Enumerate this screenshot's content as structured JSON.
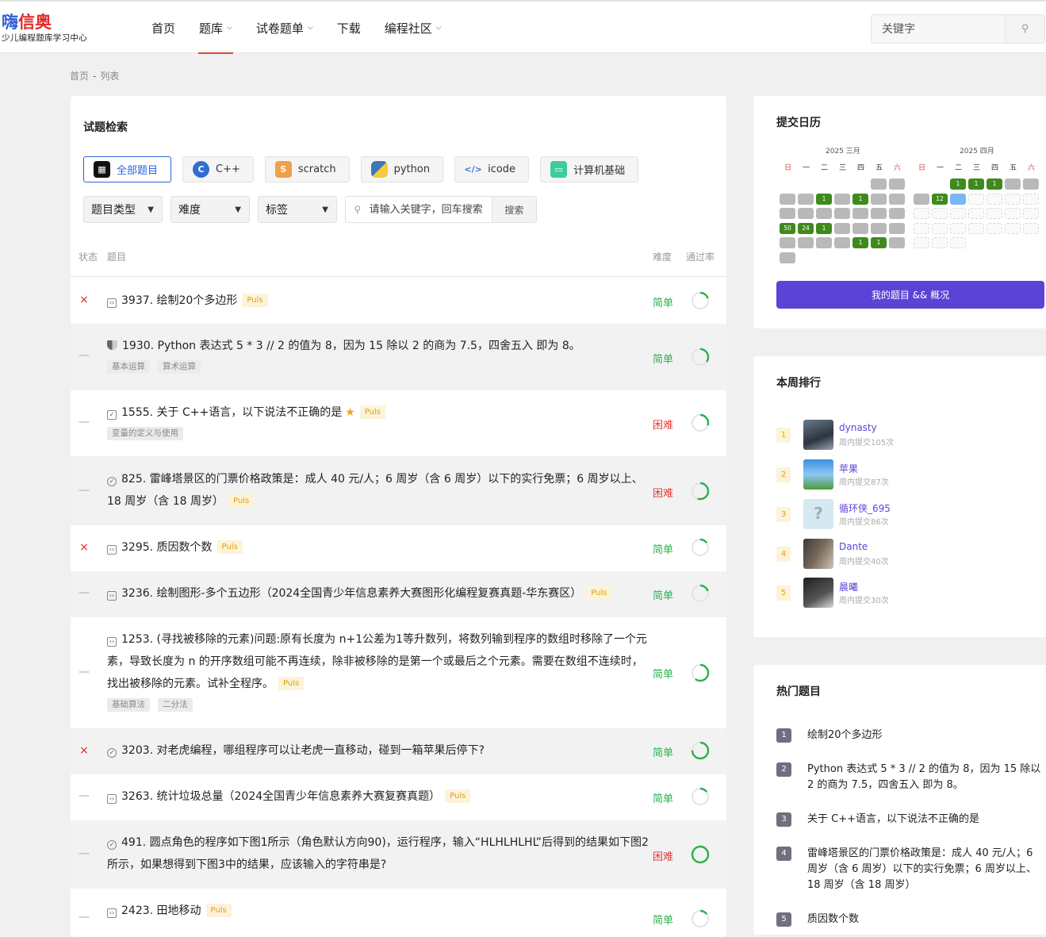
{
  "header": {
    "logo_part1": "嗨",
    "logo_part2": "信奥",
    "slogan": "少儿编程题库学习中心",
    "nav": [
      "首页",
      "题库",
      "试卷题单",
      "下载",
      "编程社区"
    ],
    "search_placeholder": "关键字"
  },
  "breadcrumb": {
    "home": "首页",
    "sep": "-",
    "current": "列表"
  },
  "main": {
    "title": "试题检索",
    "categories": [
      "全部题目",
      "C++",
      "scratch",
      "python",
      "icode",
      "计算机基础"
    ],
    "filters": {
      "type": "题目类型",
      "difficulty": "难度",
      "tag": "标签",
      "keyword_placeholder": "请输入关键字，回车搜索",
      "search_btn": "搜索"
    },
    "columns": {
      "status": "状态",
      "title": "题目",
      "difficulty": "难度",
      "rate": "通过率"
    },
    "problems": [
      {
        "status": "×",
        "title": "3937. 绘制20个多边形",
        "puls": "Puls",
        "diff": "简单",
        "rate": 0.2
      },
      {
        "status": "—",
        "title": "1930. Python 表达式 5 * 3 // 2 的值为 8，因为 15 除以 2 的商为 7.5，四舍五入 即为 8。",
        "tags": [
          "基本运算",
          "算术运算"
        ],
        "diff": "简单",
        "rate": 0.35
      },
      {
        "status": "—",
        "title": "1555. 关于 C++语言，以下说法不正确的是",
        "puls": "Puls",
        "tags": [
          "变量的定义与使用"
        ],
        "diff": "困难",
        "rate": 0.3
      },
      {
        "status": "—",
        "title": "825. 雷峰塔景区的门票价格政策是：成人 40 元/人；6 周岁（含 6 周岁）以下的实行免票；6 周岁以上、18 周岁（含 18 周岁）",
        "puls": "Puls",
        "diff": "困难",
        "rate": 0.55
      },
      {
        "status": "×",
        "title": "3295. 质因数个数",
        "puls": "Puls",
        "diff": "简单",
        "rate": 0.15
      },
      {
        "status": "—",
        "title": "3236. 绘制图形-多个五边形（2024全国青少年信息素养大赛图形化编程复赛真题-华东赛区）",
        "puls": "Puls",
        "diff": "简单",
        "rate": 0.2
      },
      {
        "status": "—",
        "title": "1253. (寻找被移除的元素)问题:原有长度为 n+1公差为1等升数列，将数列输到程序的数组时移除了一个元素，导致长度为 n 的开序数组可能不再连续，除非被移除的是第一个或最后之个元素。需要在数组不连续时，找出被移除的元素。试补全程序。",
        "puls": "Puls",
        "tags": [
          "基础算法",
          "二分法"
        ],
        "diff": "简单",
        "rate": 0.6
      },
      {
        "status": "×",
        "title": "3203. 对老虎编程，哪组程序可以让老虎一直移动，碰到一箱苹果后停下?",
        "diff": "简单",
        "rate": 0.75
      },
      {
        "status": "—",
        "title": "3263. 统计垃圾总量（2024全国青少年信息素养大赛复赛真题）",
        "puls": "Puls",
        "diff": "简单",
        "rate": 0.15
      },
      {
        "status": "—",
        "title": "491. 圆点角色的程序如下图1所示（角色默认方向90)，运行程序，输入“HLHLHLHL”后得到的结果如下图2所示，如果想得到下图3中的结果，应该输入的字符串是?",
        "diff": "困难",
        "rate": 1.0
      },
      {
        "status": "—",
        "title": "2423. 田地移动",
        "puls": "Puls",
        "diff": "简单",
        "rate": 0.15
      }
    ]
  },
  "calendar": {
    "title": "提交日历",
    "months": [
      "2025 三月",
      "2025 四月"
    ],
    "weekdays": [
      "日",
      "一",
      "二",
      "三",
      "四",
      "五",
      "六"
    ],
    "march": [
      [
        null,
        null,
        null,
        null,
        null,
        0,
        0
      ],
      [
        0,
        0,
        "1",
        0,
        "1",
        0,
        0
      ],
      [
        0,
        0,
        0,
        0,
        0,
        0,
        0
      ],
      [
        "50",
        "24",
        "1",
        0,
        0,
        0,
        0
      ],
      [
        0,
        0,
        0,
        0,
        "1",
        "1",
        0
      ],
      [
        0,
        null,
        null,
        null,
        null,
        null,
        null
      ]
    ],
    "april": [
      [
        null,
        null,
        "1",
        "1",
        "1",
        0,
        0
      ],
      [
        0,
        "12",
        "b",
        "e",
        "e",
        "e",
        "e"
      ],
      [
        "e",
        "e",
        "e",
        "e",
        "e",
        "e",
        "e"
      ],
      [
        "e",
        "e",
        "e",
        "e",
        "e",
        "e",
        "e"
      ],
      [
        "e",
        "e",
        "e",
        null,
        null,
        null,
        null
      ]
    ],
    "button": "我的题目 && 概况"
  },
  "ranking": {
    "title": "本周排行",
    "items": [
      {
        "no": "1",
        "name": "dynasty",
        "count": "周内提交105次"
      },
      {
        "no": "2",
        "name": "苹果",
        "count": "周内提交87次"
      },
      {
        "no": "3",
        "name": "循环侠_695",
        "count": "周内提交86次"
      },
      {
        "no": "4",
        "name": "Dante",
        "count": "周内提交40次"
      },
      {
        "no": "5",
        "name": "晨曦",
        "count": "周内提交30次"
      }
    ]
  },
  "hot": {
    "title": "热门题目",
    "items": [
      {
        "no": "1",
        "text": "绘制20个多边形"
      },
      {
        "no": "2",
        "text": "Python 表达式 5 * 3 // 2 的值为 8，因为 15 除以 2 的商为 7.5，四舍五入 即为 8。"
      },
      {
        "no": "3",
        "text": "关于 C++语言，以下说法不正确的是"
      },
      {
        "no": "4",
        "text": "雷峰塔景区的门票价格政策是：成人 40 元/人；6 周岁（含 6 周岁）以下的实行免票；6 周岁以上、18 周岁（含 18 周岁）"
      },
      {
        "no": "5",
        "text": "质因数个数"
      }
    ]
  }
}
